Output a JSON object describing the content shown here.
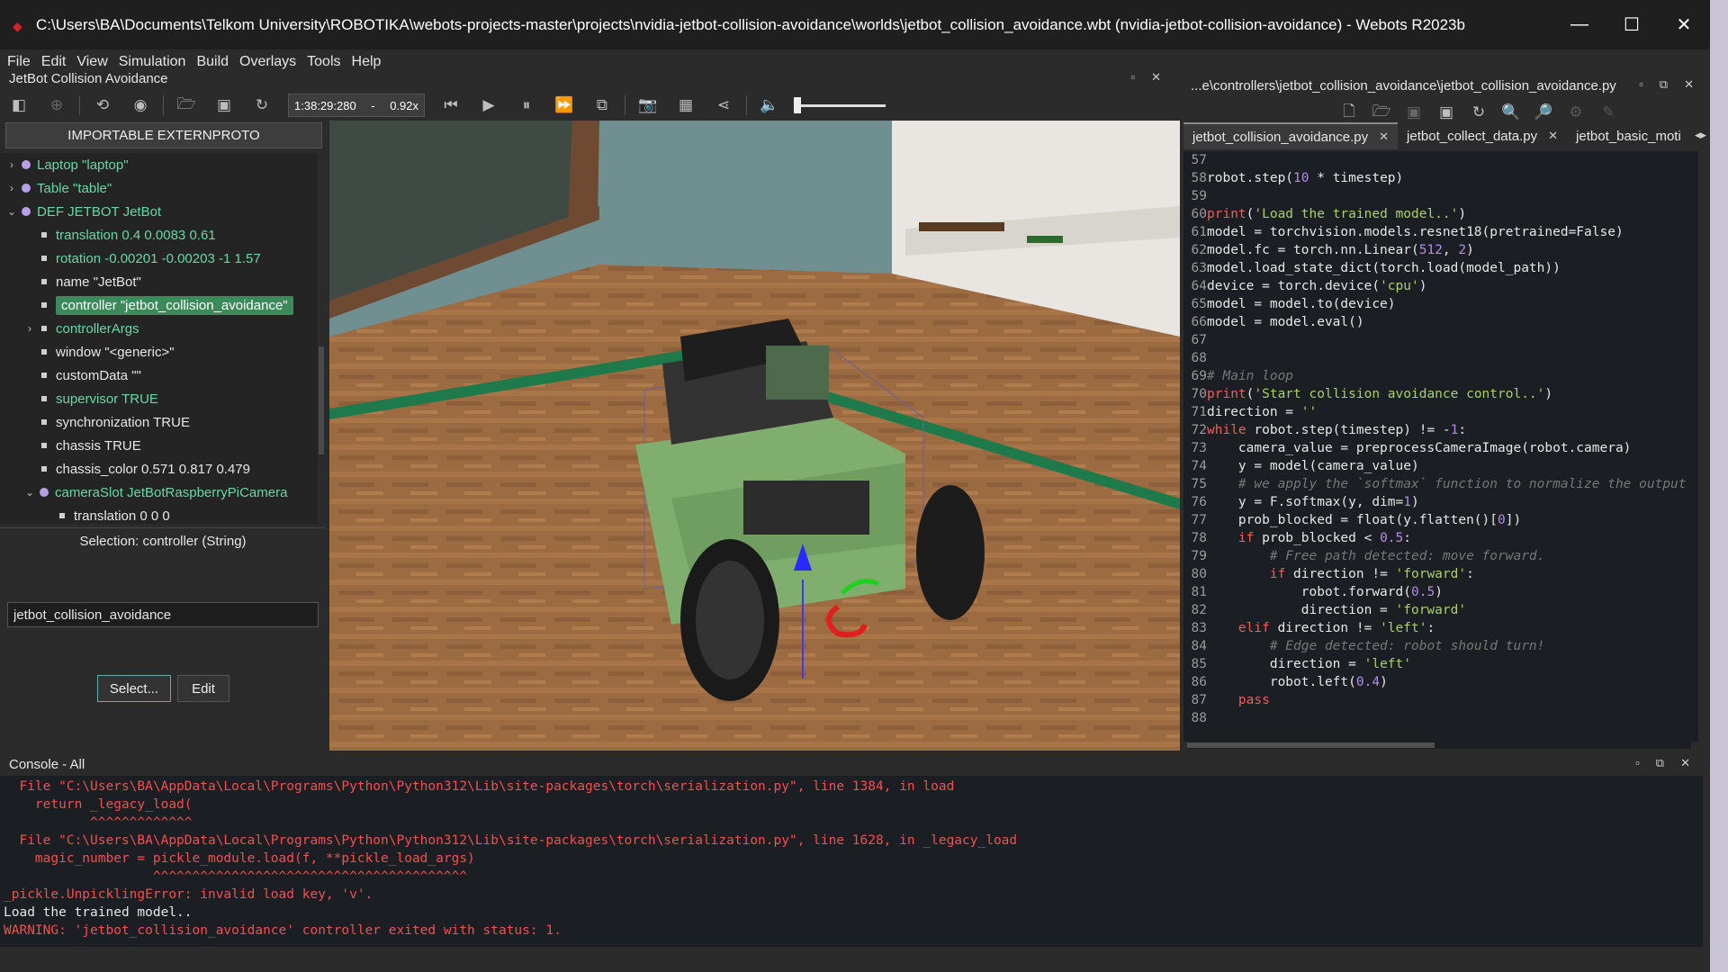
{
  "window": {
    "title": "C:\\Users\\BA\\Documents\\Telkom University\\ROBOTIKA\\webots-projects-master\\projects\\nvidia-jetbot-collision-avoidance\\worlds\\jetbot_collision_avoidance.wbt (nvidia-jetbot-collision-avoidance) - Webots R2023b",
    "minimize": "—",
    "maximize": "☐",
    "close": "✕"
  },
  "menu": [
    "File",
    "Edit",
    "View",
    "Simulation",
    "Build",
    "Overlays",
    "Tools",
    "Help"
  ],
  "scene_panel": {
    "title": "JetBot Collision Avoidance",
    "import_button": "IMPORTABLE EXTERNPROTO",
    "tree": [
      {
        "arrow": "›",
        "bullet": "dot",
        "label": "Laptop \"laptop\"",
        "style": "green",
        "indent": 0
      },
      {
        "arrow": "›",
        "bullet": "dot",
        "label": "Table \"table\"",
        "style": "green",
        "indent": 0
      },
      {
        "arrow": "⌄",
        "bullet": "dot",
        "label": "DEF JETBOT JetBot",
        "style": "green",
        "indent": 0
      },
      {
        "arrow": "",
        "bullet": "sq",
        "label": "translation 0.4 0.0083 0.61",
        "style": "green",
        "indent": 1
      },
      {
        "arrow": "",
        "bullet": "sq",
        "label": "rotation -0.00201 -0.00203 -1 1.57",
        "style": "green",
        "indent": 1
      },
      {
        "arrow": "",
        "bullet": "sq",
        "label": "name \"JetBot\"",
        "style": "",
        "indent": 1
      },
      {
        "arrow": "",
        "bullet": "sq",
        "label": "controller \"jetbot_collision_avoidance\"",
        "style": "sel",
        "indent": 1
      },
      {
        "arrow": "›",
        "bullet": "sq",
        "label": "controllerArgs",
        "style": "green",
        "indent": 1
      },
      {
        "arrow": "",
        "bullet": "sq",
        "label": "window \"<generic>\"",
        "style": "",
        "indent": 1
      },
      {
        "arrow": "",
        "bullet": "sq",
        "label": "customData \"\"",
        "style": "",
        "indent": 1
      },
      {
        "arrow": "",
        "bullet": "sq",
        "label": "supervisor TRUE",
        "style": "green",
        "indent": 1
      },
      {
        "arrow": "",
        "bullet": "sq",
        "label": "synchronization TRUE",
        "style": "",
        "indent": 1
      },
      {
        "arrow": "",
        "bullet": "sq",
        "label": "chassis TRUE",
        "style": "",
        "indent": 1
      },
      {
        "arrow": "",
        "bullet": "sq",
        "label": "chassis_color 0.571 0.817 0.479",
        "style": "",
        "indent": 1
      },
      {
        "arrow": "⌄",
        "bullet": "dot",
        "label": "cameraSlot JetBotRaspberryPiCamera",
        "style": "green",
        "indent": 1
      },
      {
        "arrow": "",
        "bullet": "sq",
        "label": "translation 0 0 0",
        "style": "",
        "indent": 2
      }
    ],
    "selection_label": "Selection: controller (String)",
    "selection_value": "jetbot_collision_avoidance",
    "select_button": "Select...",
    "edit_button": "Edit"
  },
  "toolbar": {
    "time": "1:38:29:280",
    "separator": "-",
    "speed": "0.92x"
  },
  "editor": {
    "path": "...e\\controllers\\jetbot_collision_avoidance\\jetbot_collision_avoidance.py",
    "tabs": [
      {
        "label": "jetbot_collision_avoidance.py",
        "close": "✕"
      },
      {
        "label": "jetbot_collect_data.py",
        "close": "✕"
      },
      {
        "label": "jetbot_basic_moti",
        "close": ""
      }
    ],
    "lines": [
      {
        "n": "57",
        "code": ""
      },
      {
        "n": "58",
        "code": "robot.step(10 * timestep)"
      },
      {
        "n": "59",
        "code": ""
      },
      {
        "n": "60",
        "code": "print('Load the trained model..')"
      },
      {
        "n": "61",
        "code": "model = torchvision.models.resnet18(pretrained=False)"
      },
      {
        "n": "62",
        "code": "model.fc = torch.nn.Linear(512, 2)"
      },
      {
        "n": "63",
        "code": "model.load_state_dict(torch.load(model_path))"
      },
      {
        "n": "64",
        "code": "device = torch.device('cpu')"
      },
      {
        "n": "65",
        "code": "model = model.to(device)"
      },
      {
        "n": "66",
        "code": "model = model.eval()"
      },
      {
        "n": "67",
        "code": ""
      },
      {
        "n": "68",
        "code": ""
      },
      {
        "n": "69",
        "code": "# Main loop"
      },
      {
        "n": "70",
        "code": "print('Start collision avoidance control..')"
      },
      {
        "n": "71",
        "code": "direction = ''"
      },
      {
        "n": "72",
        "code": "while robot.step(timestep) != -1:"
      },
      {
        "n": "73",
        "code": "    camera_value = preprocessCameraImage(robot.camera)"
      },
      {
        "n": "74",
        "code": "    y = model(camera_value)"
      },
      {
        "n": "75",
        "code": "    # we apply the `softmax` function to normalize the output"
      },
      {
        "n": "76",
        "code": "    y = F.softmax(y, dim=1)"
      },
      {
        "n": "77",
        "code": "    prob_blocked = float(y.flatten()[0])"
      },
      {
        "n": "78",
        "code": "    if prob_blocked < 0.5:"
      },
      {
        "n": "79",
        "code": "        # Free path detected: move forward."
      },
      {
        "n": "80",
        "code": "        if direction != 'forward':"
      },
      {
        "n": "81",
        "code": "            robot.forward(0.5)"
      },
      {
        "n": "82",
        "code": "            direction = 'forward'"
      },
      {
        "n": "83",
        "code": "    elif direction != 'left':"
      },
      {
        "n": "84",
        "code": "        # Edge detected: robot should turn!"
      },
      {
        "n": "85",
        "code": "        direction = 'left'"
      },
      {
        "n": "86",
        "code": "        robot.left(0.4)"
      },
      {
        "n": "87",
        "code": "    pass"
      },
      {
        "n": "88",
        "code": ""
      }
    ]
  },
  "console": {
    "title": "Console - All",
    "lines": [
      {
        "t": "err",
        "text": "  File \"C:\\Users\\BA\\AppData\\Local\\Programs\\Python\\Python312\\Lib\\site-packages\\torch\\serialization.py\", line 1384, in load"
      },
      {
        "t": "err",
        "text": "    return _legacy_load("
      },
      {
        "t": "err",
        "text": "           ^^^^^^^^^^^^^"
      },
      {
        "t": "err",
        "text": "  File \"C:\\Users\\BA\\AppData\\Local\\Programs\\Python\\Python312\\Lib\\site-packages\\torch\\serialization.py\", line 1628, in _legacy_load"
      },
      {
        "t": "err",
        "text": "    magic_number = pickle_module.load(f, **pickle_load_args)"
      },
      {
        "t": "err",
        "text": "                   ^^^^^^^^^^^^^^^^^^^^^^^^^^^^^^^^^^^^^^^^"
      },
      {
        "t": "err",
        "text": "_pickle.UnpicklingError: invalid load key, 'v'."
      },
      {
        "t": "normal",
        "text": "Load the trained model.."
      },
      {
        "t": "warn",
        "text": "WARNING: 'jetbot_collision_avoidance' controller exited with status: 1."
      }
    ]
  }
}
